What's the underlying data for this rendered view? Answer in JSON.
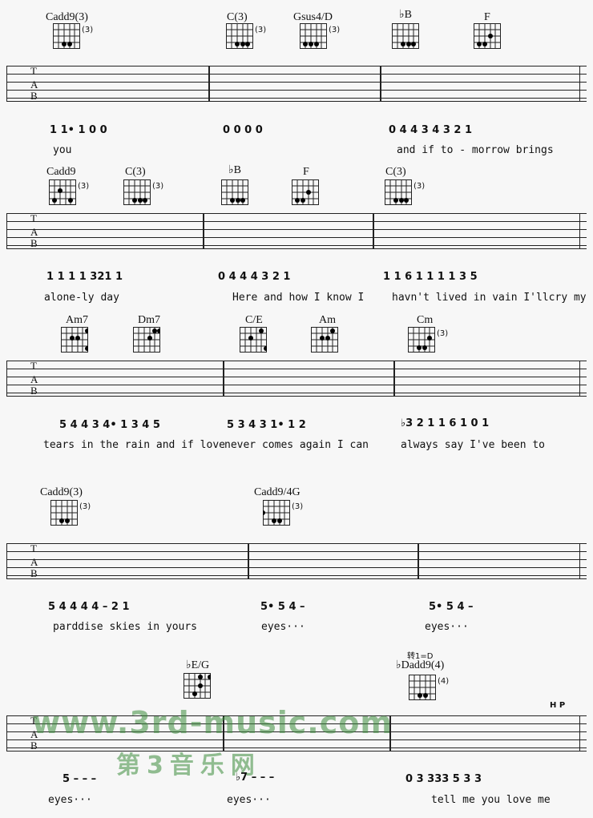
{
  "score": {
    "key_change": "转1=D",
    "hp_marking": "H P",
    "systems": [
      {
        "chords": [
          {
            "name": "Cadd9(3)",
            "fret": "(3)"
          },
          {
            "name": "C(3)",
            "fret": "(3)"
          },
          {
            "name": "Gsus4/D",
            "fret": "(3)"
          },
          {
            "name": "♭B",
            "fret": ""
          },
          {
            "name": "F",
            "fret": ""
          }
        ],
        "notation": [
          "1 1• 1  0  0",
          "0  0  0  0",
          "0 4  4 3  4  3  2 1"
        ],
        "lyrics": [
          "you",
          "",
          "and if  to  - morrow  brings"
        ]
      },
      {
        "chords": [
          {
            "name": "Cadd9",
            "fret": "(3)"
          },
          {
            "name": "C(3)",
            "fret": "(3)"
          },
          {
            "name": "♭B",
            "fret": ""
          },
          {
            "name": "F",
            "fret": ""
          },
          {
            "name": "C(3)",
            "fret": "(3)"
          }
        ],
        "notation": [
          "1 1  1 1  321  1",
          "0  4 4  4 3  2  1",
          "1 1 6  1  1 1  1  3 5"
        ],
        "lyrics": [
          "alone-ly  day",
          "Here and how I know I",
          "havn't lived in vain I'llcry my"
        ]
      },
      {
        "chords": [
          {
            "name": "Am7",
            "fret": ""
          },
          {
            "name": "Dm7",
            "fret": ""
          },
          {
            "name": "C/E",
            "fret": ""
          },
          {
            "name": "Am",
            "fret": ""
          },
          {
            "name": "Cm",
            "fret": "(3)"
          }
        ],
        "notation": [
          "5 4  4 3  4• 1  3 4 5",
          "5 3  4 3 1•  1 2",
          "♭3  2  1  1 6  1  0 1"
        ],
        "lyrics": [
          "tears in the  rain and if  love",
          "never comes again  I can",
          "always  say  I've been  to"
        ]
      },
      {
        "chords": [
          {
            "name": "Cadd9(3)",
            "fret": "(3)"
          },
          {
            "name": "Cadd9/4G",
            "fret": "(3)"
          }
        ],
        "notation": [
          "5  4 4  4  4  –  2 1",
          "5•  5  4  –",
          "5•  5  4  –"
        ],
        "lyrics": [
          "parddise  skies  in yours",
          "eyes···",
          "eyes···"
        ]
      },
      {
        "chords": [
          {
            "name": "♭E/G",
            "fret": ""
          },
          {
            "name": "♭Dadd9(4)",
            "fret": "(4)"
          }
        ],
        "notation": [
          "5  –  –  –",
          "♭7  –  –  –",
          "0  3 333  5 3  3"
        ],
        "lyrics": [
          "eyes···",
          "eyes···",
          "tell me you  love  me"
        ]
      }
    ]
  },
  "watermark": {
    "url": "www.3rd-music.com",
    "name": "第3音乐网",
    "color": "#3c8c3c"
  },
  "tab_letters": [
    "T",
    "A",
    "B"
  ]
}
